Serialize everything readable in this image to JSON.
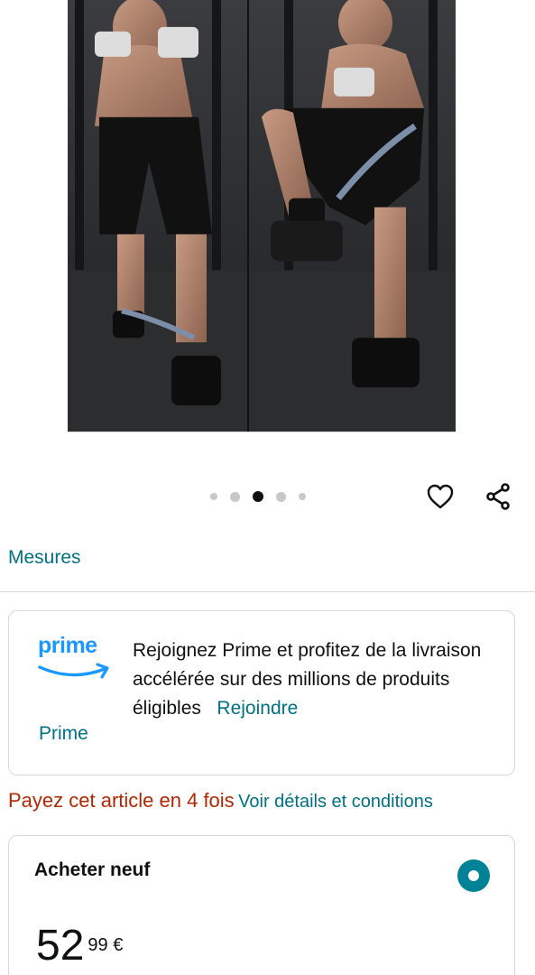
{
  "product": {
    "image_alt": "Deux hommes s'entraînant avec des bandes de résistance",
    "carousel": {
      "total": 5,
      "active_index": 2
    }
  },
  "actions": {
    "wishlist_icon": "heart-icon",
    "share_icon": "share-icon"
  },
  "mesures_label": "Mesures",
  "prime": {
    "logo_text": "prime",
    "message": "Rejoignez Prime et profitez de la livraison accélérée sur des millions de produits éligibles",
    "join_link_part1": "Rejoindre",
    "join_link_part2": "Prime"
  },
  "installments": {
    "text": "Payez cet article en 4 fois",
    "link": "Voir détails et conditions"
  },
  "buy": {
    "title": "Acheter neuf",
    "price_whole": "52",
    "price_fraction": "99 €"
  },
  "colors": {
    "link": "#007185",
    "price_red": "#b12704",
    "prime_blue": "#1a98ff",
    "radio_teal": "#008296"
  }
}
